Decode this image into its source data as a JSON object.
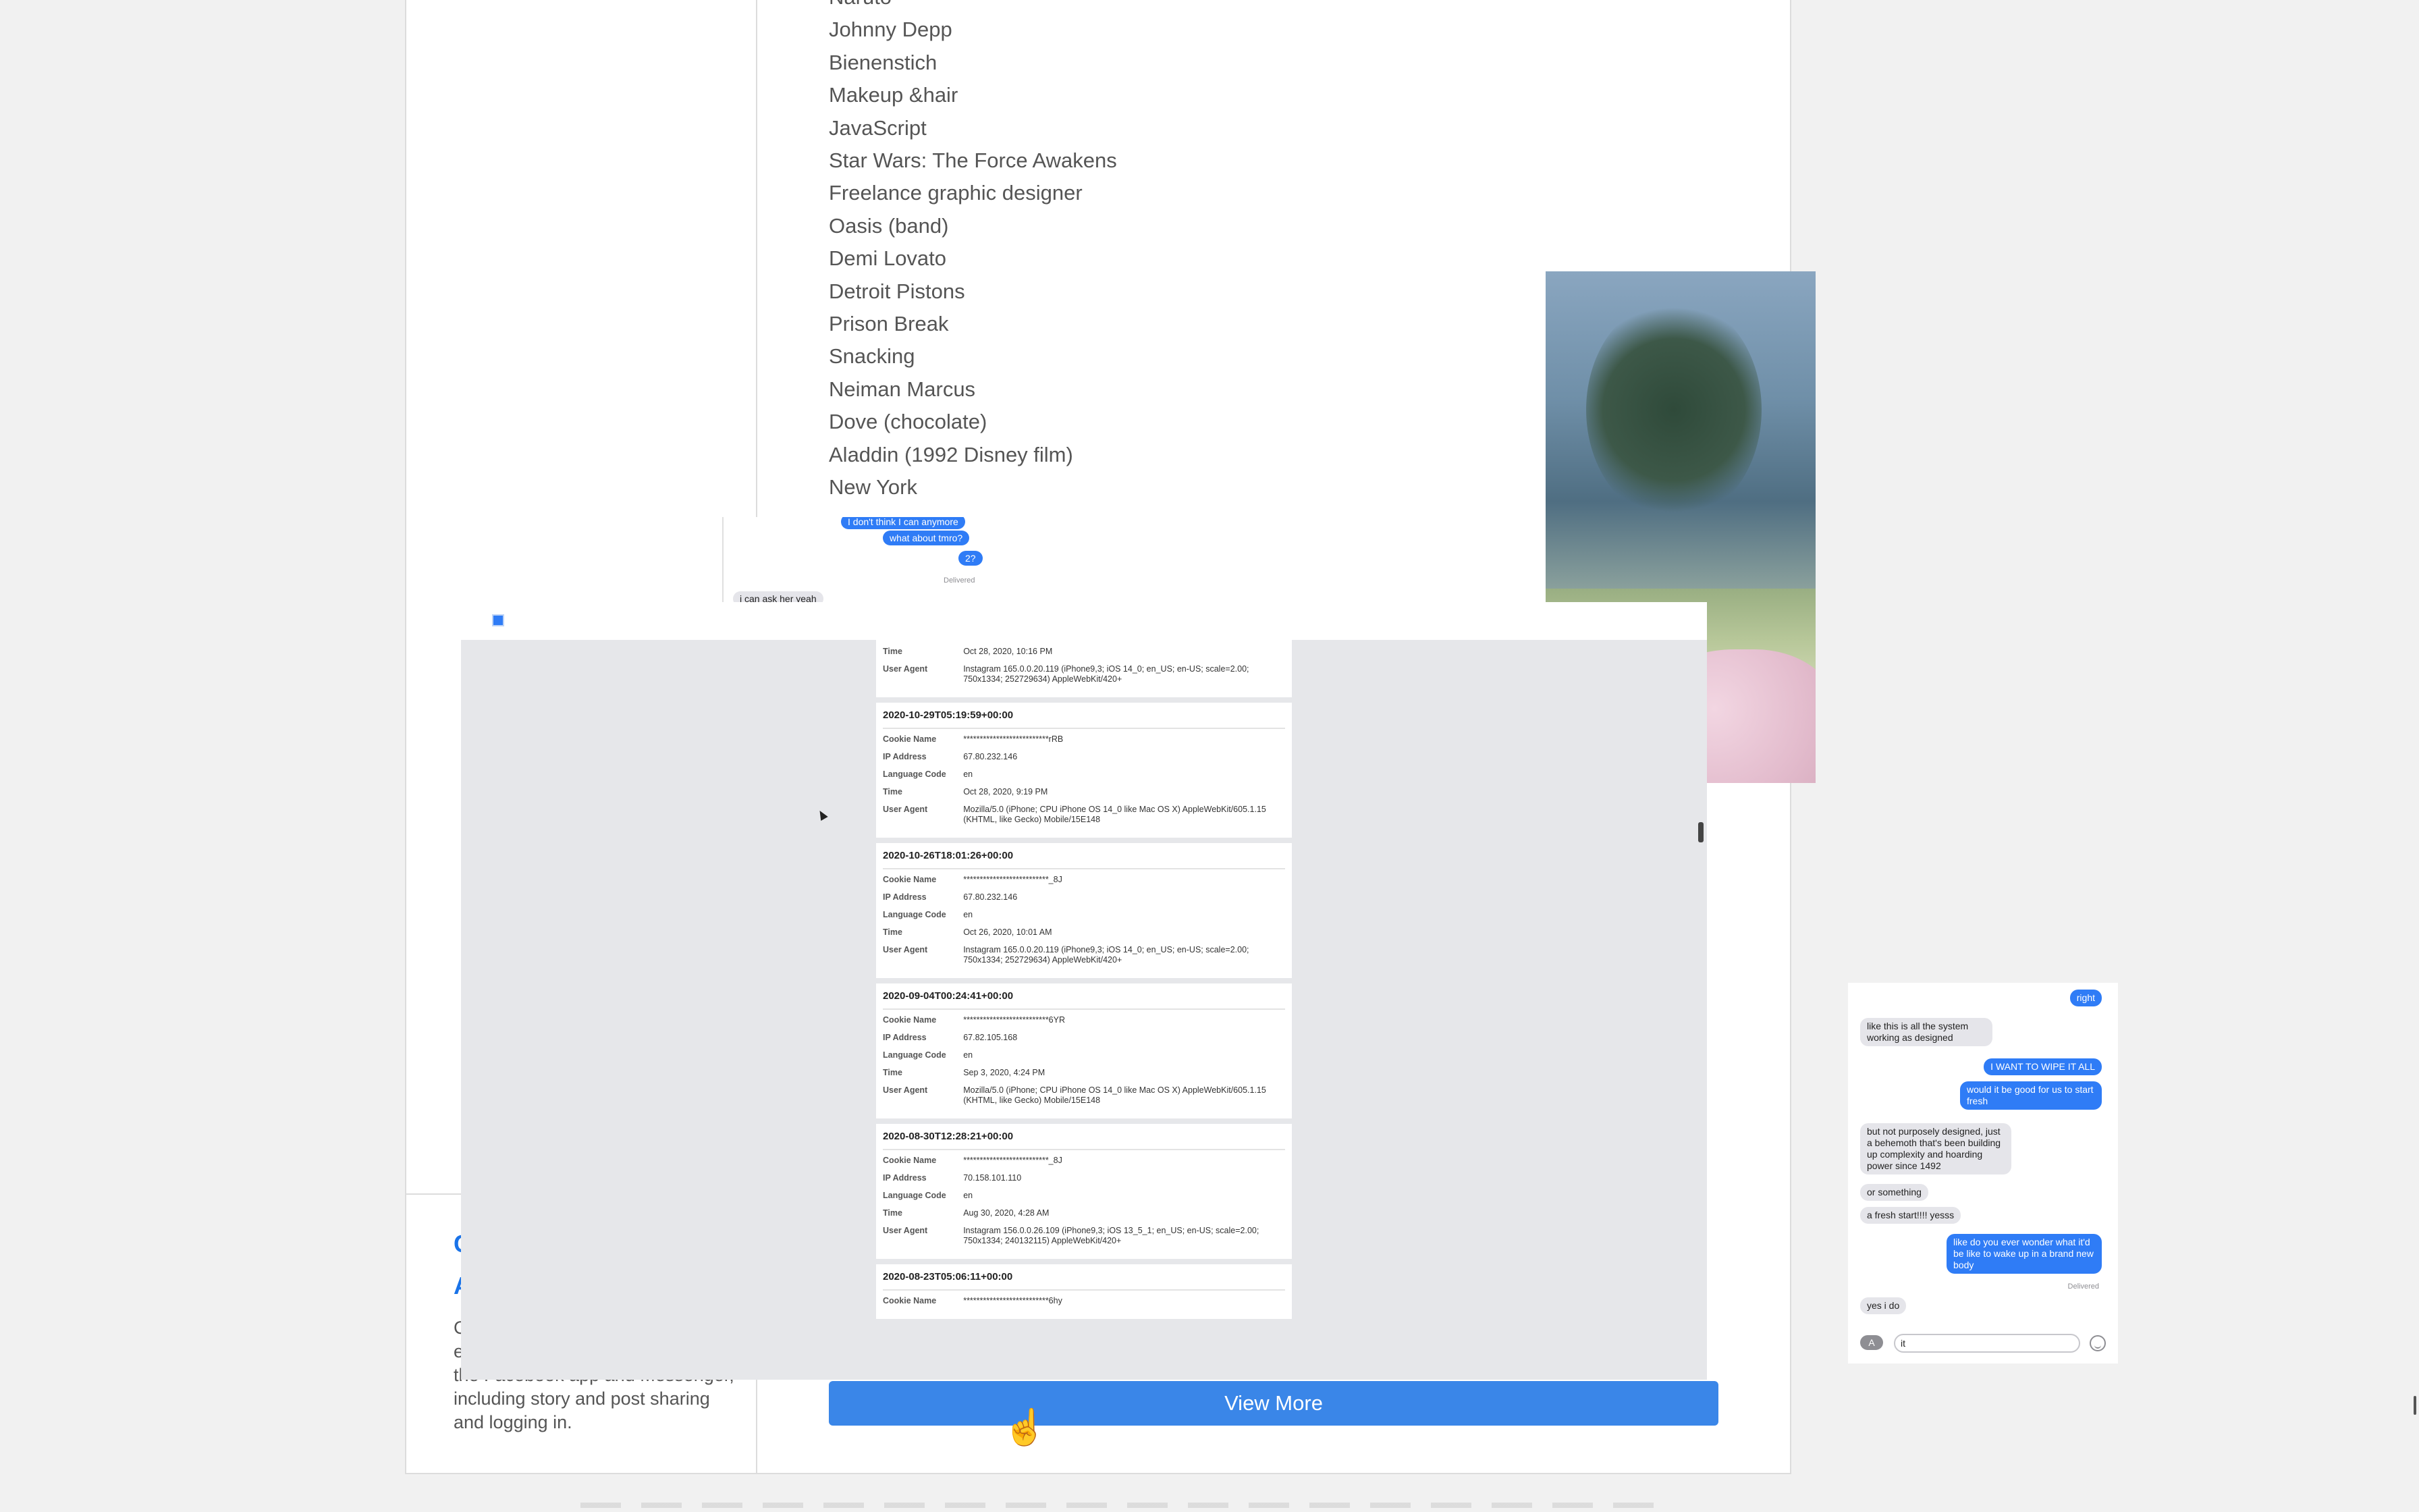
{
  "interests": [
    "Naruto",
    "Johnny Depp",
    "Bienenstich",
    "Makeup &hair",
    "JavaScript",
    "Star Wars: The Force Awakens",
    "Freelance graphic designer",
    "Oasis (band)",
    "Demi Lovato",
    "Detroit Pistons",
    "Prison Break",
    "Snacking",
    "Neiman Marcus",
    "Dove (chocolate)",
    "Aladdin (1992 Disney film)",
    "New York"
  ],
  "side_panel": {
    "title_line1": "C",
    "title_line2": "A",
    "description": "C\ne\nthe Facebook app and Messenger, including story and post sharing and logging in."
  },
  "view_more_label": "View More",
  "imessage_back": {
    "msg1": "I don't think I can anymore",
    "msg2": "what about tmro?",
    "msg3": "2?",
    "delivered": "Delivered",
    "msg4": "i can ask her yeah"
  },
  "activity_log": {
    "labels": {
      "cookie": "Cookie Name",
      "ip": "IP Address",
      "lang": "Language Code",
      "time": "Time",
      "ua": "User Agent"
    },
    "top_partial": {
      "time": "Oct 28, 2020, 10:16 PM",
      "ua": "Instagram 165.0.0.20.119 (iPhone9,3; iOS 14_0; en_US; en-US; scale=2.00; 750x1334; 252729634) AppleWebKit/420+"
    },
    "entries": [
      {
        "timestamp": "2020-10-29T05:19:59+00:00",
        "cookie": "**************************rRB",
        "ip": "67.80.232.146",
        "lang": "en",
        "time": "Oct 28, 2020, 9:19 PM",
        "ua": "Mozilla/5.0 (iPhone; CPU iPhone OS 14_0 like Mac OS X) AppleWebKit/605.1.15 (KHTML, like Gecko) Mobile/15E148"
      },
      {
        "timestamp": "2020-10-26T18:01:26+00:00",
        "cookie": "**************************_8J",
        "ip": "67.80.232.146",
        "lang": "en",
        "time": "Oct 26, 2020, 10:01 AM",
        "ua": "Instagram 165.0.0.20.119 (iPhone9,3; iOS 14_0; en_US; en-US; scale=2.00; 750x1334; 252729634) AppleWebKit/420+"
      },
      {
        "timestamp": "2020-09-04T00:24:41+00:00",
        "cookie": "**************************6YR",
        "ip": "67.82.105.168",
        "lang": "en",
        "time": "Sep 3, 2020, 4:24 PM",
        "ua": "Mozilla/5.0 (iPhone; CPU iPhone OS 14_0 like Mac OS X) AppleWebKit/605.1.15 (KHTML, like Gecko) Mobile/15E148"
      },
      {
        "timestamp": "2020-08-30T12:28:21+00:00",
        "cookie": "**************************_8J",
        "ip": "70.158.101.110",
        "lang": "en",
        "time": "Aug 30, 2020, 4:28 AM",
        "ua": "Instagram 156.0.0.26.109 (iPhone9,3; iOS 13_5_1; en_US; en-US; scale=2.00; 750x1334; 240132115) AppleWebKit/420+"
      },
      {
        "timestamp": "2020-08-23T05:06:11+00:00",
        "cookie": "**************************6hy",
        "ip": "",
        "lang": "",
        "time": "",
        "ua": ""
      }
    ]
  },
  "imessage_right": {
    "m1": "right",
    "m2": "like this is all the system working as designed",
    "m3": "I WANT TO WIPE IT ALL",
    "m4": "would it be good for us to start fresh",
    "m5": "but not purposely designed, just a behemoth that's been building up complexity and hoarding power since 1492",
    "m6": "or something",
    "m7": "a fresh start!!!! yesss",
    "m8": "like do you ever wonder what it'd be like to wake up in a brand new body",
    "delivered": "Delivered",
    "m9": "yes i do",
    "input_value": "it"
  },
  "colors": {
    "accent": "#3a86e8",
    "imessage_blue": "#2f7cf6",
    "imessage_gray": "#e5e5ea",
    "link": "#1a73e8"
  }
}
